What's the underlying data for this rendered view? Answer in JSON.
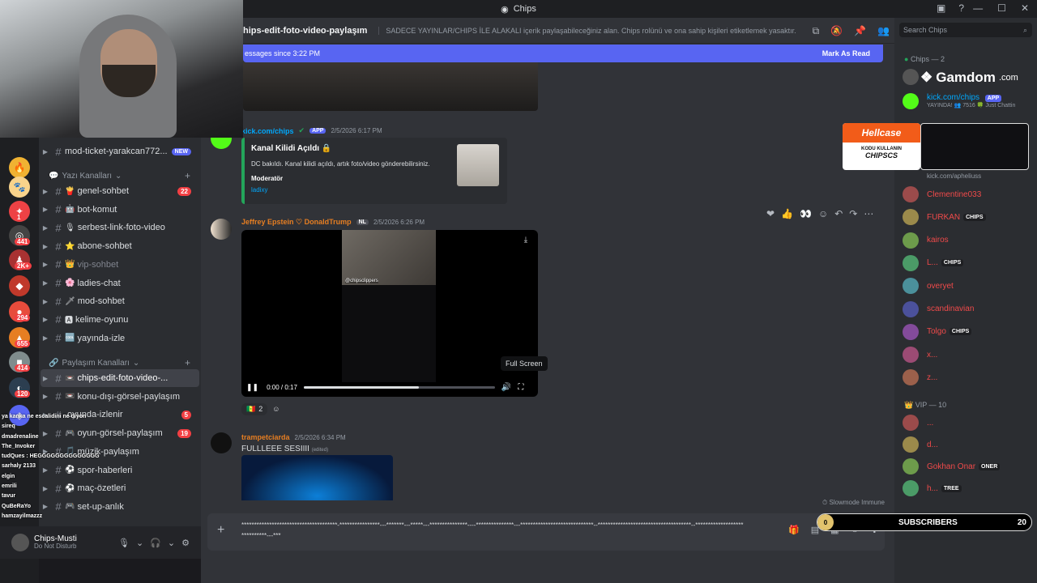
{
  "window": {
    "title": "Chips"
  },
  "header": {
    "channel": "hips-edit-foto-video-paylaşım",
    "topic": "SADECE YAYINLAR/CHIPS İLE ALAKALI içerik paylaşabileceğiniz alan. Chips rolünü ve ona sahip kişileri etiketlemek yasaktır.",
    "search_placeholder": "Search Chips"
  },
  "new_messages": {
    "text": "essages since 3:22 PM",
    "action": "Mark As Read"
  },
  "server_badges": [
    "1",
    "441",
    "2K+",
    "294",
    "655",
    "414",
    "120"
  ],
  "channels": {
    "top_item": {
      "name": "mod-ticket-yarakcan772...",
      "badge": "NEW"
    },
    "cat1": "Yazı Kanalları",
    "list1": [
      {
        "name": "genel-sohbet",
        "badge": "22",
        "emoji": "🍟"
      },
      {
        "name": "bot-komut",
        "badge": "",
        "emoji": "🤖"
      },
      {
        "name": "serbest-link-foto-video",
        "badge": "",
        "emoji": "🎙"
      },
      {
        "name": "abone-sohbet",
        "badge": "",
        "emoji": "⭐"
      },
      {
        "name": "vip-sohbet",
        "badge": "",
        "emoji": "👑"
      },
      {
        "name": "ladies-chat",
        "badge": "",
        "emoji": "🌸"
      },
      {
        "name": "mod-sohbet",
        "badge": "",
        "emoji": "🗡"
      },
      {
        "name": "kelime-oyunu",
        "badge": "",
        "emoji": "🅰"
      },
      {
        "name": "yayında-izle",
        "badge": "",
        "emoji": "🆒"
      }
    ],
    "cat2": "Paylaşım Kanalları",
    "list2": [
      {
        "name": "chips-edit-foto-video-...",
        "badge": "",
        "emoji": "📼"
      },
      {
        "name": "konu-dışı-görsel-paylaşım",
        "badge": "",
        "emoji": "📼"
      },
      {
        "name": "oyunda-izlenir",
        "badge": "5",
        "emoji": ""
      },
      {
        "name": "oyun-görsel-paylaşım",
        "badge": "19",
        "emoji": "🎮"
      },
      {
        "name": "müzik-paylaşım",
        "badge": "",
        "emoji": "🎵"
      },
      {
        "name": "spor-haberleri",
        "badge": "",
        "emoji": "⚽"
      },
      {
        "name": "maç-özetleri",
        "badge": "",
        "emoji": "⚽"
      },
      {
        "name": "set-up-anlık",
        "badge": "",
        "emoji": "🎮"
      }
    ]
  },
  "user": {
    "name": "Chips-Musti",
    "status": "Do Not Disturb"
  },
  "messages": {
    "m1": {
      "author": "kick.com/chips",
      "tag": "APP",
      "time": "2/5/2026 6:17 PM",
      "embed_title": "Kanal Kilidi Açıldı 🔒",
      "embed_desc": "DC bakıldı. Kanal kilidi açıldı, artık foto/video gönderebilirsiniz.",
      "field_name": "Moderatör",
      "field_value": "ladixy"
    },
    "m2": {
      "author": "Jeffrey Epstein ♡ DonaldTrump",
      "tag": "NL",
      "time": "2/5/2026 6:26 PM",
      "video_watermark": "@chipsclippers",
      "video_time": "0:00 / 0:17",
      "video_progress": 0.6,
      "tooltip": "Full Screen",
      "reaction_count": "2"
    },
    "m3": {
      "author": "trampetciarda",
      "time": "2/5/2026 6:34 PM",
      "text": "FULLLEEE SESIIII",
      "edited": "(edited)"
    }
  },
  "slowmode": "Slowmode Immune",
  "composer": {
    "text": "**************************************-****************---*******---*****---***************----***************---*****************************--*************************************--*****************************---***"
  },
  "members": {
    "group1": "Chips — 2",
    "kick": {
      "name": "kick.com/chips",
      "tag": "APP",
      "activity": "YAYINDA! 👥 7516 🍀 Just Chattin"
    },
    "link": "kick.com/apheliuss",
    "list1": [
      {
        "name": "Clementine033",
        "color": "#f04a4a",
        "tag": ""
      },
      {
        "name": "FURKAN",
        "color": "#f04a4a",
        "tag": "CHIPS"
      },
      {
        "name": "kairos",
        "color": "#f04a4a",
        "tag": ""
      },
      {
        "name": "L...",
        "color": "#f04a4a",
        "tag": "CHIPS"
      },
      {
        "name": "overyet",
        "color": "#f04a4a",
        "tag": ""
      },
      {
        "name": "scandinavian",
        "color": "#f04a4a",
        "tag": ""
      },
      {
        "name": "Tolgo",
        "color": "#f04a4a",
        "tag": "CHIPS"
      },
      {
        "name": "x...",
        "color": "#f04a4a",
        "tag": ""
      },
      {
        "name": "z...",
        "color": "#f04a4a",
        "tag": ""
      }
    ],
    "group2": "VIP — 10",
    "list2": [
      {
        "name": "...",
        "color": "#f04a4a",
        "tag": ""
      },
      {
        "name": "d...",
        "color": "#f04a4a",
        "tag": ""
      },
      {
        "name": "Gokhan Onar",
        "color": "#f04a4a",
        "tag": "ONER"
      },
      {
        "name": "h...",
        "color": "#f04a4a",
        "tag": "TREE"
      }
    ]
  },
  "overlays": {
    "sponsor1": "Gamdom",
    "sponsor1_tld": ".com",
    "sponsor2": "Hellcase",
    "sponsor2_line1": "KODU KULLANIN",
    "sponsor2_code": "CHIPSCS",
    "subs_label": "SUBSCRIBERS",
    "subs_count": "20",
    "subs_circle": "0",
    "chat": [
      "ya kanka ne escalidini ne diyon",
      "sireq",
      "dmadrenaline",
      "The_Invoker",
      "tudQues : HEGGGGGGGGGGGGGG",
      "sarhaly 2133",
      "elgin",
      "emrili",
      "tavur",
      "QuBeRaYo",
      "hamzayilmazzz"
    ]
  }
}
